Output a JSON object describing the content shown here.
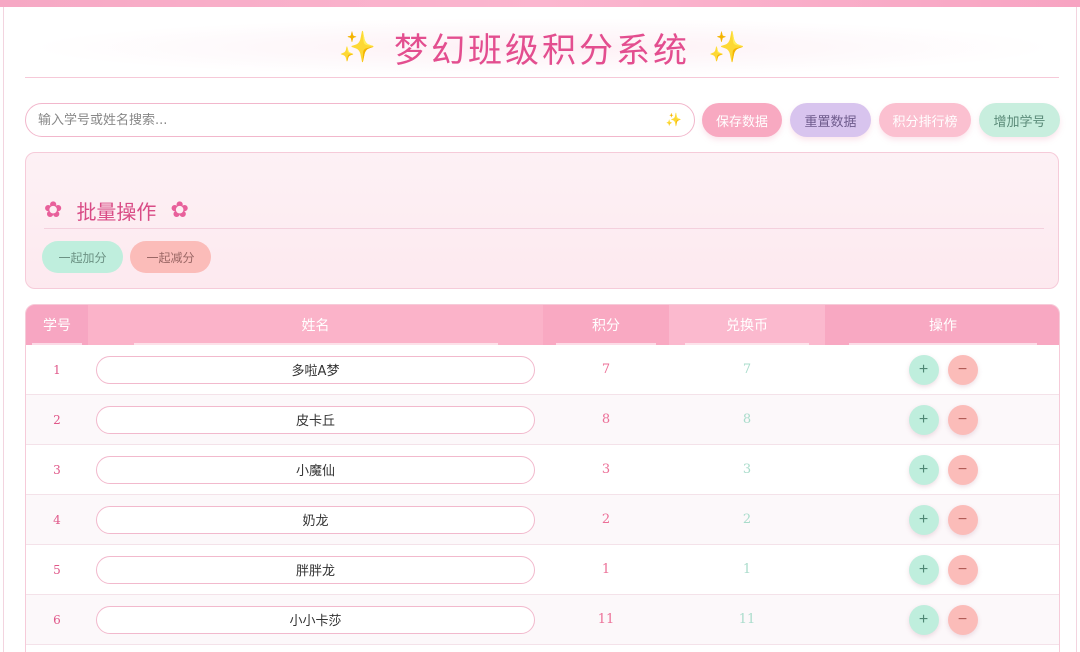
{
  "header": {
    "title": "梦幻班级积分系统",
    "left_icon": "sparkles-icon",
    "right_icon": "sparkles-icon"
  },
  "toolbar": {
    "search_placeholder": "输入学号或姓名搜索...",
    "save_label": "保存数据",
    "reset_label": "重置数据",
    "rank_label": "积分排行榜",
    "add_label": "增加学号"
  },
  "batch": {
    "title": "批量操作",
    "add_all_label": "一起加分",
    "sub_all_label": "一起减分"
  },
  "table": {
    "columns": [
      "学号",
      "姓名",
      "积分",
      "兑换币",
      "操作"
    ],
    "rows": [
      {
        "id": "1",
        "name": "多啦A梦",
        "score": "7",
        "coins": "7"
      },
      {
        "id": "2",
        "name": "皮卡丘",
        "score": "8",
        "coins": "8"
      },
      {
        "id": "3",
        "name": "小魔仙",
        "score": "3",
        "coins": "3"
      },
      {
        "id": "4",
        "name": "奶龙",
        "score": "2",
        "coins": "2"
      },
      {
        "id": "5",
        "name": "胖胖龙",
        "score": "1",
        "coins": "1"
      },
      {
        "id": "6",
        "name": "小小卡莎",
        "score": "11",
        "coins": "11"
      }
    ],
    "plus_label": "+",
    "minus_label": "−"
  },
  "colors": {
    "accent": "#e34e8f",
    "header_pink": "#f8a4c0",
    "mint": "#bfeedd",
    "coral": "#fbbcb9",
    "lavender": "#d8c4ee"
  }
}
